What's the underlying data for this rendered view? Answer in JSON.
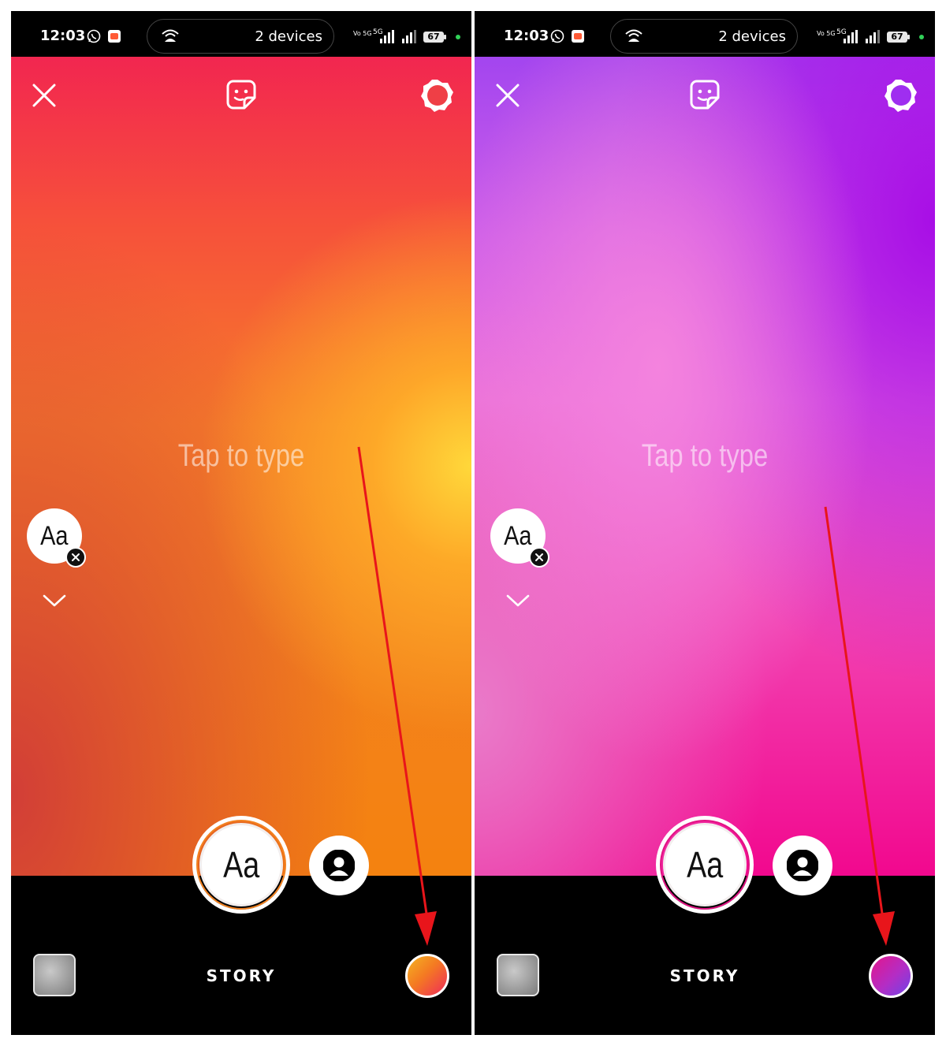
{
  "screens": [
    {
      "id": "left",
      "status": {
        "time": "12:03",
        "hotspot_text": "2 devices",
        "net": "Vo 5G",
        "net_5g": "5G",
        "battery": "67"
      },
      "editor": {
        "placeholder": "Tap to type",
        "font_button_label": "Aa",
        "text_mode_label": "Aa"
      },
      "bottom": {
        "mode_label": "STORY"
      },
      "colors": {
        "background_top": "#f22650",
        "background_mid": "#f57b2a",
        "background_accent": "#ffd83a",
        "color_swatch": [
          "#f4b423",
          "#f47a22",
          "#ef2a5a"
        ]
      }
    },
    {
      "id": "right",
      "status": {
        "time": "12:03",
        "hotspot_text": "2 devices",
        "net": "Vo 5G",
        "net_5g": "5G",
        "battery": "67"
      },
      "editor": {
        "placeholder": "Tap to type",
        "font_button_label": "Aa",
        "text_mode_label": "Aa"
      },
      "bottom": {
        "mode_label": "STORY"
      },
      "colors": {
        "background_top": "#a345ef",
        "background_mid": "#ec70dd",
        "background_accent": "#f2088e",
        "color_swatch": [
          "#e3168c",
          "#b32dc5",
          "#6e44e6"
        ]
      }
    }
  ],
  "icons": [
    "close-icon",
    "sticker-icon",
    "settings-icon",
    "chevron-down-icon",
    "mention-icon",
    "whatsapp-icon",
    "hotspot-icon",
    "signal-icon"
  ],
  "annotation": {
    "type": "red-arrow",
    "color": "#e8151b",
    "target": "color-button"
  }
}
